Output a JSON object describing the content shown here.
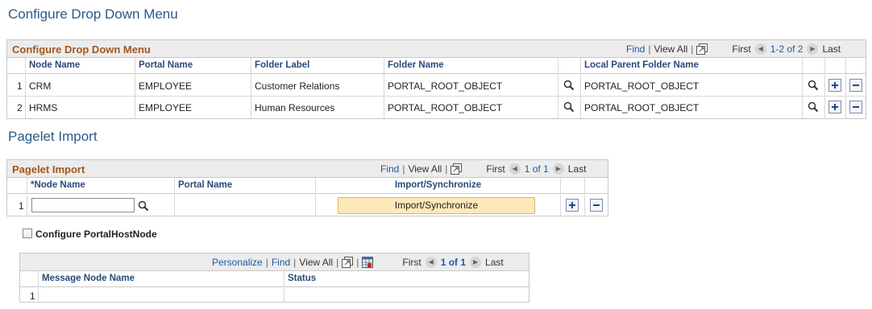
{
  "page": {
    "title": "Configure Drop Down Menu"
  },
  "dropdown_grid": {
    "title": "Configure Drop Down Menu",
    "nav": {
      "find": "Find",
      "view_all": "View All",
      "first": "First",
      "range": "1-2 of 2",
      "last": "Last"
    },
    "columns": [
      "Node Name",
      "Portal Name",
      "Folder Label",
      "Folder Name",
      "Local Parent Folder Name"
    ],
    "rows": [
      {
        "num": "1",
        "node": "CRM",
        "portal": "EMPLOYEE",
        "label": "Customer Relations",
        "folder": "PORTAL_ROOT_OBJECT",
        "parent": "PORTAL_ROOT_OBJECT"
      },
      {
        "num": "2",
        "node": "HRMS",
        "portal": "EMPLOYEE",
        "label": "Human Resources",
        "folder": "PORTAL_ROOT_OBJECT",
        "parent": "PORTAL_ROOT_OBJECT"
      }
    ]
  },
  "pagelet_section": {
    "title": "Pagelet Import"
  },
  "pagelet_grid": {
    "title": "Pagelet Import",
    "nav": {
      "find": "Find",
      "view_all": "View All",
      "first": "First",
      "range": "1 of 1",
      "last": "Last"
    },
    "columns": [
      "*Node Name",
      "Portal Name",
      "Import/Synchronize"
    ],
    "rows": [
      {
        "num": "1",
        "node_value": "",
        "portal": "",
        "button": "Import/Synchronize"
      }
    ]
  },
  "portal_host": {
    "label": "Configure PortalHostNode",
    "checked": false
  },
  "message_grid": {
    "nav": {
      "personalize": "Personalize",
      "find": "Find",
      "view_all": "View All",
      "first": "First",
      "range": "1 of 1",
      "last": "Last"
    },
    "columns": [
      "Message Node Name",
      "Status"
    ],
    "rows": [
      {
        "num": "1",
        "node": "",
        "status": ""
      }
    ]
  },
  "colors": {
    "title": "#2a5a8a",
    "grid_title": "#a2571c",
    "link": "#1c5aa6",
    "button_bg": "#fde9b8"
  }
}
